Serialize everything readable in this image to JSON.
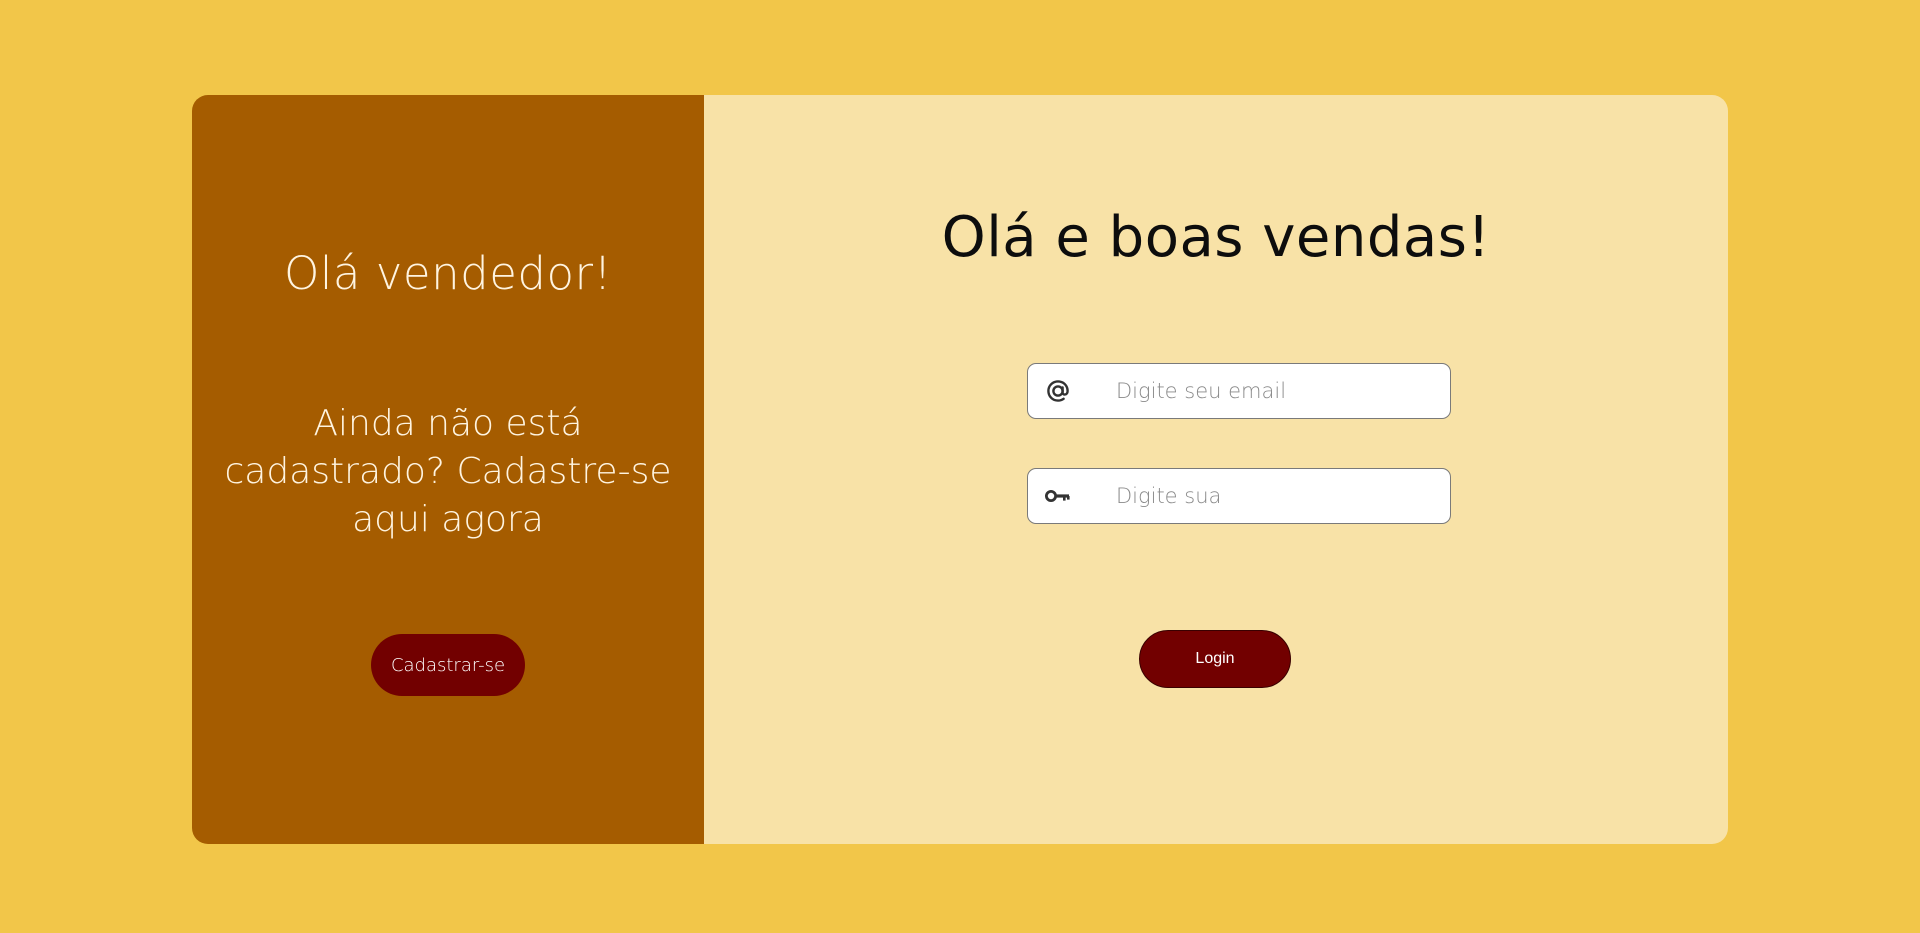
{
  "left_panel": {
    "title": "Olá vendedor!",
    "text": "Ainda não está cadastrado? Cadastre-se aqui agora",
    "signup_label": "Cadastrar-se"
  },
  "right_panel": {
    "title": "Olá e boas vendas!",
    "email_placeholder": "Digite seu email",
    "password_placeholder": "Digite sua",
    "login_label": "Login"
  },
  "icons": {
    "email": "at-icon",
    "password": "key-icon"
  },
  "colors": {
    "background": "#f2c649",
    "left_panel": "#a55c00",
    "right_panel": "#f8e2a7",
    "button": "#720000"
  }
}
